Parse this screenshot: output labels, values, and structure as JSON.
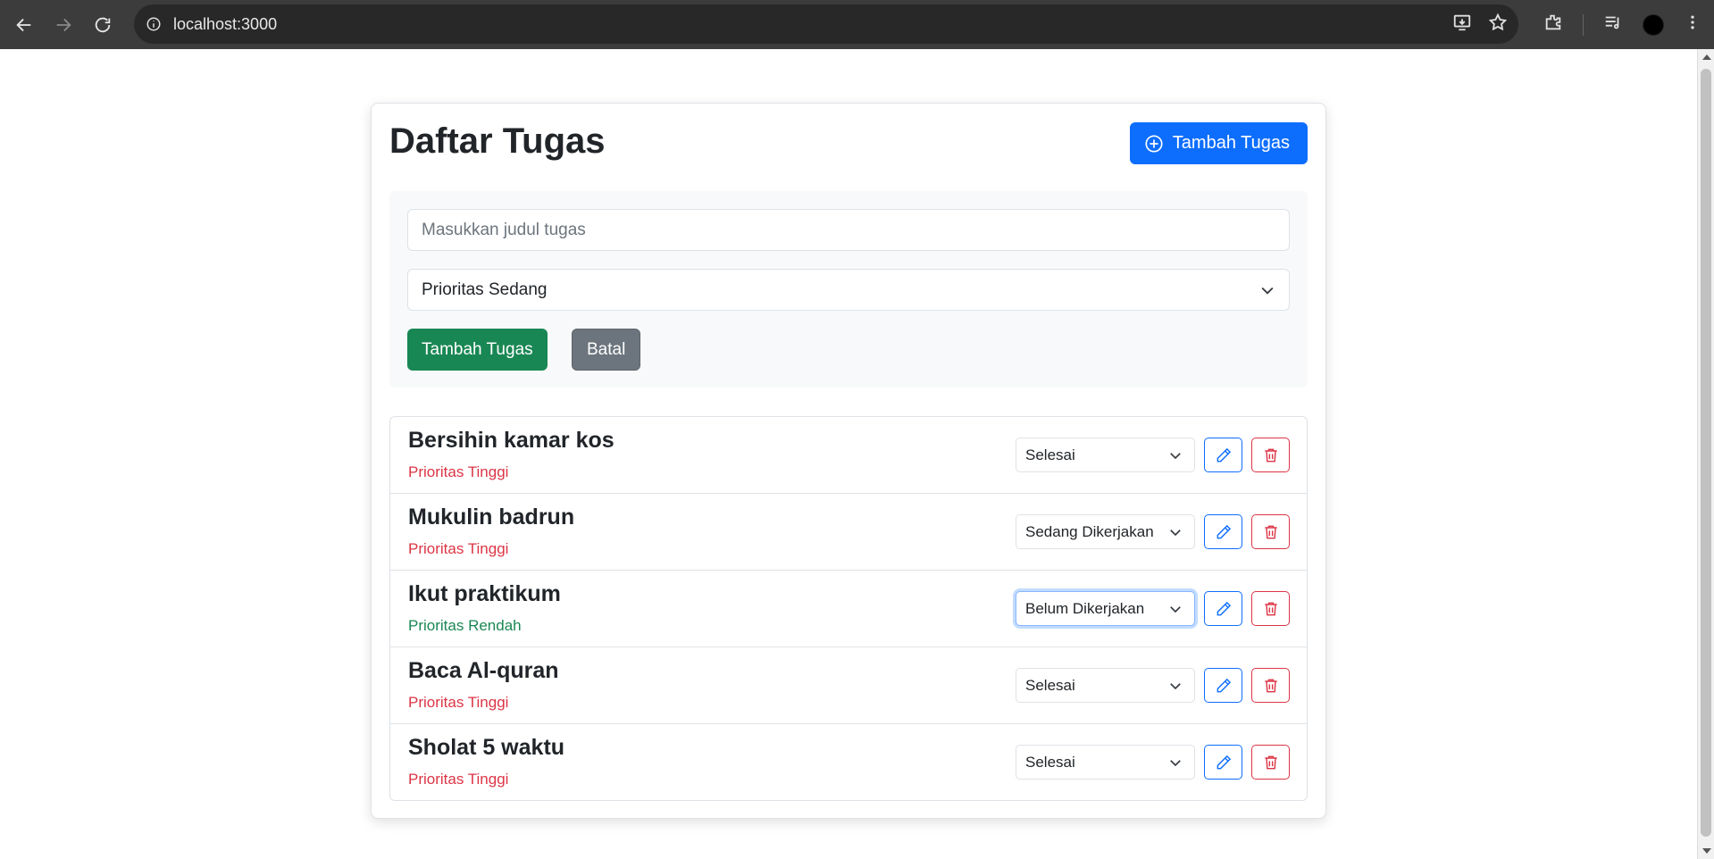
{
  "browser": {
    "url": "localhost:3000"
  },
  "page": {
    "title": "Daftar Tugas",
    "add_button_label": "Tambah Tugas"
  },
  "form": {
    "title_placeholder": "Masukkan judul tugas",
    "title_value": "",
    "priority_selected": "Prioritas Sedang",
    "submit_label": "Tambah Tugas",
    "cancel_label": "Batal"
  },
  "tasks": [
    {
      "title": "Bersihin kamar kos",
      "priority": "Prioritas Tinggi",
      "priority_level": "high",
      "status": "Selesai"
    },
    {
      "title": "Mukulin badrun",
      "priority": "Prioritas Tinggi",
      "priority_level": "high",
      "status": "Sedang Dikerjakan"
    },
    {
      "title": "Ikut praktikum",
      "priority": "Prioritas Rendah",
      "priority_level": "low",
      "status": "Belum Dikerjakan"
    },
    {
      "title": "Baca Al-quran",
      "priority": "Prioritas Tinggi",
      "priority_level": "high",
      "status": "Selesai"
    },
    {
      "title": "Sholat 5 waktu",
      "priority": "Prioritas Tinggi",
      "priority_level": "high",
      "status": "Selesai"
    }
  ],
  "colors": {
    "primary": "#0d6efd",
    "success": "#198754",
    "secondary": "#6c757d",
    "danger": "#dc3545"
  }
}
